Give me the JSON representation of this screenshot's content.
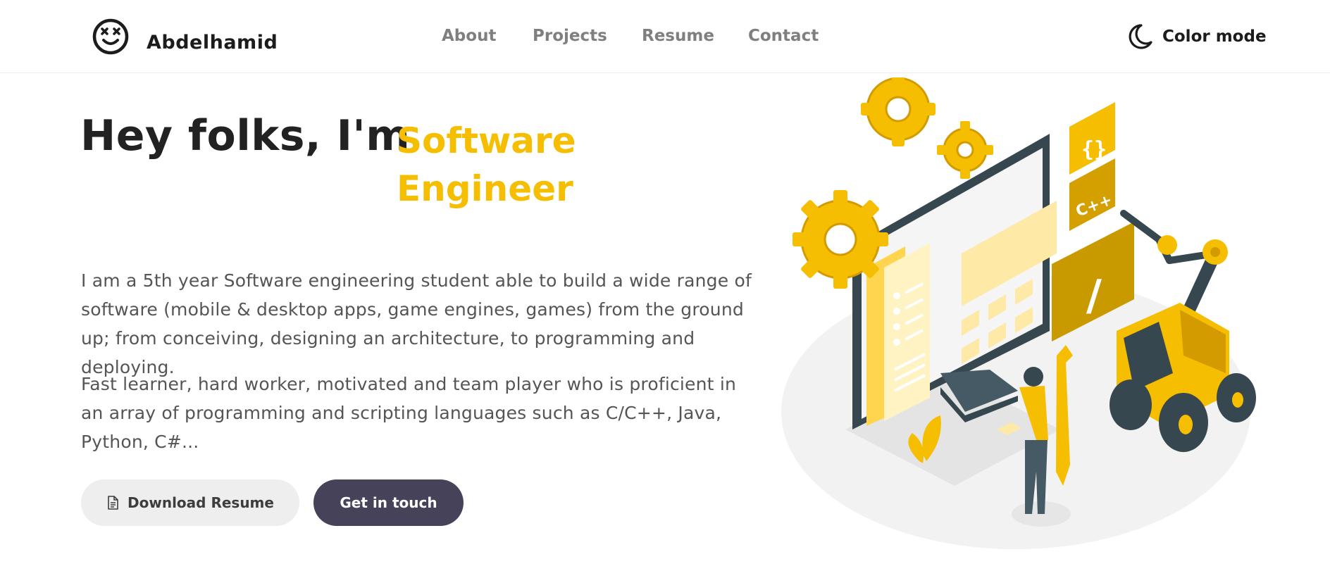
{
  "header": {
    "brand": "Abdelhamid",
    "logo_icon": "smiley-face-icon",
    "nav": [
      "About",
      "Projects",
      "Resume",
      "Contact"
    ],
    "color_mode_icon": "moon-icon",
    "color_mode_label": "Color mode"
  },
  "hero": {
    "greeting": "Hey folks, I'm",
    "role": "Software Engineer",
    "paragraph1": "I am a 5th year Software engineering student able to build a wide range of software (mobile & desktop apps, game engines, games) from the ground up; from conceiving, designing an architecture, to programming and deploying.",
    "paragraph2": "Fast learner, hard worker, motivated and team player who is proficient in an array of programming and scripting languages such as C/C++, Java, Python, C#...",
    "download_button": "Download Resume",
    "download_icon": "document-icon",
    "contact_button": "Get in touch",
    "illustration_labels": {
      "braces": "{}",
      "language": "C++",
      "slash": "/"
    }
  },
  "colors": {
    "accent": "#f6be00",
    "dark_button": "#454259",
    "light_button": "#eeeeee"
  }
}
